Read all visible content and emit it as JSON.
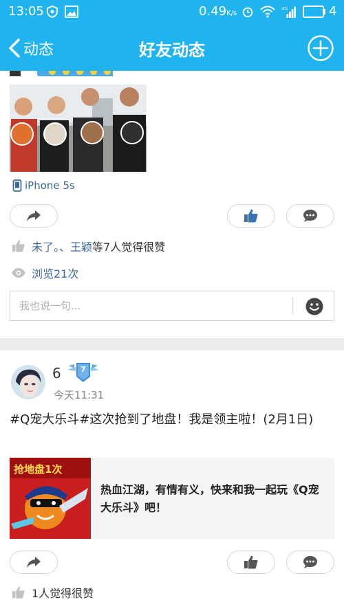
{
  "status_bar": {
    "time": "13:05",
    "speed": "0.49",
    "speed_unit": "K/s",
    "battery_level": "4"
  },
  "nav": {
    "back_label": "动态",
    "title": "好友动态"
  },
  "post1": {
    "device": "iPhone 5s",
    "likes_names": "未了。、王颖",
    "likes_suffix": "等7人觉得很赞",
    "views": "浏览21次",
    "comment_placeholder": "我也说一句..."
  },
  "post2": {
    "username": "6",
    "badge_text": "7",
    "time": "今天11:31",
    "text": "#Q宠大乐斗#这次抢到了地盘！我是领主啦！(2月1日)",
    "share_thumb_text": "抢地盘1次",
    "share_text": "热血江湖，有情有义，快来和我一起玩《Q宠大乐斗》吧！",
    "likes_text": "1人觉得很赞"
  },
  "colors": {
    "accent": "#1fb4f0",
    "link": "#3b6a9b",
    "icon_gray": "#c2c2c2"
  }
}
